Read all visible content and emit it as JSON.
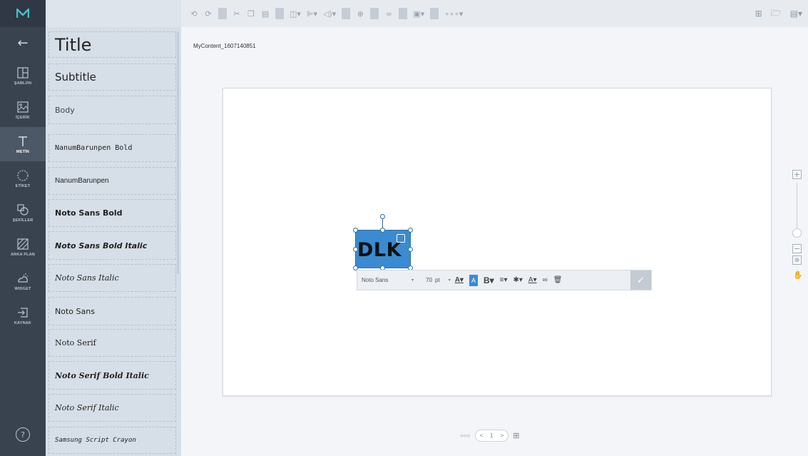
{
  "rail": {
    "items": [
      {
        "label": "ŞABLON",
        "icon": "template-icon"
      },
      {
        "label": "İÇERİK",
        "icon": "image-icon"
      },
      {
        "label": "METİN",
        "icon": "text-icon"
      },
      {
        "label": "ETİKET",
        "icon": "tag-icon"
      },
      {
        "label": "ŞEKİLLER",
        "icon": "shapes-icon"
      },
      {
        "label": "ARKA PLAN",
        "icon": "background-icon"
      },
      {
        "label": "WIDGET",
        "icon": "widget-icon"
      },
      {
        "label": "KAYNAK",
        "icon": "source-icon"
      }
    ],
    "help": "?"
  },
  "fonts": [
    "Title",
    "Subtitle",
    "Body",
    "NanumBarunpen Bold",
    "NanumBarunpen",
    "Noto Sans Bold",
    "Noto Sans Bold Italic",
    "Noto Sans Italic",
    "Noto Sans",
    "Noto Serif",
    "Noto Serif Bold Italic",
    "Noto Serif Italic",
    "Samsung Script Crayon"
  ],
  "document": {
    "filename": "MyContent_1607140851",
    "textbox_text": "DLK"
  },
  "format_toolbar": {
    "font_name": "Noto Sans",
    "font_size": "70",
    "unit": "pt"
  },
  "pager": {
    "dots": "○○○",
    "prev": "<",
    "current": "1",
    "next": ">"
  },
  "colors": {
    "rail": "#394350",
    "panel": "#d6dee7",
    "accent": "#3a8bd1",
    "logo": "#48c0c9"
  }
}
